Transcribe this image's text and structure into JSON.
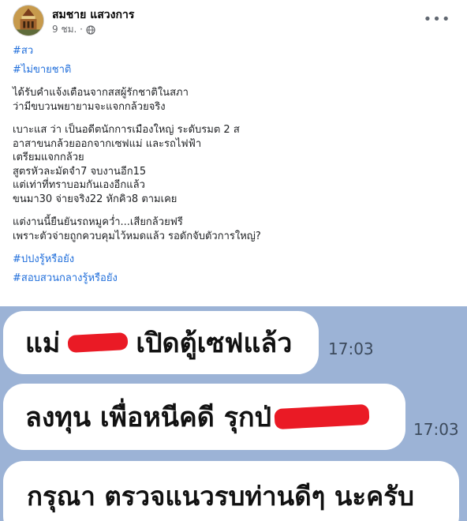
{
  "post": {
    "author_name": "สมชาย แสวงการ",
    "time": "9 ชม. ·",
    "privacy_icon": "globe-icon",
    "more_icon": "more-options-icon",
    "tags_top": [
      "#สว",
      "#ไม่ขายชาติ"
    ],
    "paragraphs": [
      [
        "ได้รับคำแจ้งเตือนจากสสผู้รักชาติในสภา",
        "ว่ามีขบวนพยายามจะแจกกล้วยจริง"
      ],
      [
        "เบาะแส ว่า เป็นอดีตนักการเมืองใหญ่ ระดับรมต 2 ส",
        "อาสาขนกล้วยออกจากเซฟแม่ และรถไฟฟ้า",
        "เตรียมแจกกล้วย",
        "สูตรหัวละมัดจำ7 จบงานอีก15",
        "แต่เท่าที่ทราบอมกันเองอีกแล้ว",
        "ขนมา30 จ่ายจริง22 หักคิว8 ตามเคย"
      ],
      [
        "แต่งานนี้ยืนยันรถหมูคว่ำ...เสียกล้วยฟรี",
        "เพราะตัวจ่ายถูกควบคุมไว้หมดแล้ว  รอดักจับตัวการใหญ่?"
      ]
    ],
    "tags_bottom": [
      "#ปปงรู้หรือยัง",
      "#สอบสวนกลางรู้หรือยัง"
    ]
  },
  "chat": {
    "messages": [
      {
        "before": "แม่",
        "after": "เปิดตู้เซฟแล้ว",
        "time": "17:03"
      },
      {
        "before": "ลงทุน เพื่อหนีคดี รุกป่",
        "after": "",
        "time": "17:03"
      },
      {
        "before": "กรุณา ตรวจแนวรบท่านดีๆ นะครับ",
        "after": "",
        "time": ""
      }
    ],
    "redaction_color": "#ea1a25",
    "background_color": "#9cb3d6"
  }
}
